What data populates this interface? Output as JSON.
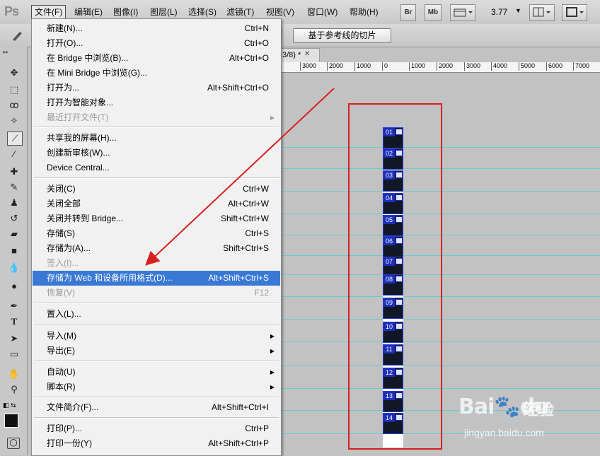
{
  "app_logo": "Ps",
  "menubar": {
    "items": [
      "文件(F)",
      "编辑(E)",
      "图像(I)",
      "图层(L)",
      "选择(S)",
      "滤镜(T)",
      "视图(V)",
      "窗口(W)",
      "帮助(H)"
    ],
    "bridge_btn": "Br",
    "minibridge_btn": "Mb",
    "zoom": "3.77"
  },
  "options_bar": {
    "slice_guides_button": "基于参考线的切片"
  },
  "document": {
    "tab_label": "3/8) *",
    "ruler_labels": [
      "3000",
      "2000",
      "1000",
      "0",
      "1000",
      "2000",
      "3000",
      "4000",
      "5000",
      "6000",
      "7000"
    ]
  },
  "slices": [
    "01",
    "02",
    "03",
    "04",
    "05",
    "06",
    "07",
    "08",
    "09",
    "10",
    "11",
    "12",
    "13",
    "14"
  ],
  "file_menu": {
    "items": [
      {
        "label": "新建(N)...",
        "shortcut": "Ctrl+N"
      },
      {
        "label": "打开(O)...",
        "shortcut": "Ctrl+O"
      },
      {
        "label": "在 Bridge 中浏览(B)...",
        "shortcut": "Alt+Ctrl+O"
      },
      {
        "label": "在 Mini Bridge 中浏览(G)...",
        "shortcut": ""
      },
      {
        "label": "打开为...",
        "shortcut": "Alt+Shift+Ctrl+O"
      },
      {
        "label": "打开为智能对象...",
        "shortcut": ""
      },
      {
        "label": "最近打开文件(T)",
        "shortcut": ""
      },
      {
        "label": "共享我的屏幕(H)...",
        "shortcut": ""
      },
      {
        "label": "创建新审核(W)...",
        "shortcut": ""
      },
      {
        "label": "Device Central...",
        "shortcut": ""
      },
      {
        "label": "关闭(C)",
        "shortcut": "Ctrl+W"
      },
      {
        "label": "关闭全部",
        "shortcut": "Alt+Ctrl+W"
      },
      {
        "label": "关闭并转到 Bridge...",
        "shortcut": "Shift+Ctrl+W"
      },
      {
        "label": "存储(S)",
        "shortcut": "Ctrl+S"
      },
      {
        "label": "存储为(A)...",
        "shortcut": "Shift+Ctrl+S"
      },
      {
        "label": "签入(I)...",
        "shortcut": ""
      },
      {
        "label": "存储为 Web 和设备所用格式(D)...",
        "shortcut": "Alt+Shift+Ctrl+S"
      },
      {
        "label": "恢复(V)",
        "shortcut": "F12"
      },
      {
        "label": "置入(L)...",
        "shortcut": ""
      },
      {
        "label": "导入(M)",
        "shortcut": ""
      },
      {
        "label": "导出(E)",
        "shortcut": ""
      },
      {
        "label": "自动(U)",
        "shortcut": ""
      },
      {
        "label": "脚本(R)",
        "shortcut": ""
      },
      {
        "label": "文件简介(F)...",
        "shortcut": "Alt+Shift+Ctrl+I"
      },
      {
        "label": "打印(P)...",
        "shortcut": "Ctrl+P"
      },
      {
        "label": "打印一份(Y)",
        "shortcut": "Alt+Shift+Ctrl+P"
      }
    ]
  },
  "watermark": {
    "logo": "Bai🐾du",
    "text": "经验",
    "url": "jingyan.baidu.com"
  },
  "colors": {
    "highlight": "#3a78d6",
    "annotation_red": "#d82020",
    "guide_cyan": "#6cc8cf",
    "slice_blue": "#1d2eb8"
  }
}
